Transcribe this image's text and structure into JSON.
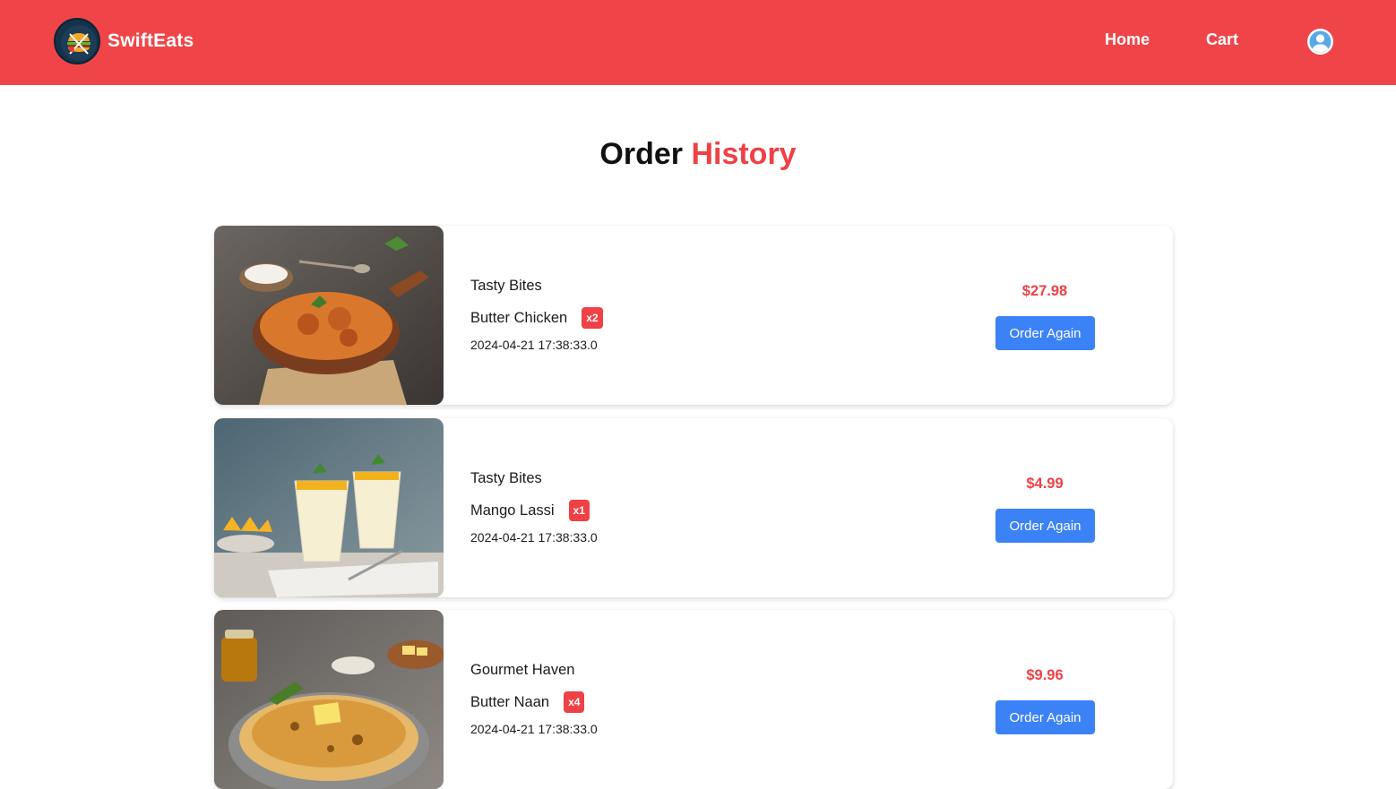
{
  "header": {
    "brand": "SwiftEats",
    "nav": {
      "home": "Home",
      "cart": "Cart"
    },
    "icons": {
      "logo": "burger-logo-icon",
      "profile": "user-avatar-icon"
    },
    "colors": {
      "navbar": "#f04548",
      "accent": "#ef4146",
      "button": "#3b82f6"
    }
  },
  "title": {
    "part1": "Order ",
    "part2": "History"
  },
  "orders": [
    {
      "restaurant": "Tasty Bites",
      "item": "Butter Chicken",
      "qty": "x2",
      "date": "2024-04-21 17:38:33.0",
      "price": "$27.98",
      "action": "Order Again",
      "image": "butter-chicken-photo"
    },
    {
      "restaurant": "Tasty Bites",
      "item": "Mango Lassi",
      "qty": "x1",
      "date": "2024-04-21 17:38:33.0",
      "price": "$4.99",
      "action": "Order Again",
      "image": "mango-lassi-photo"
    },
    {
      "restaurant": "Gourmet Haven",
      "item": "Butter Naan",
      "qty": "x4",
      "date": "2024-04-21 17:38:33.0",
      "price": "$9.96",
      "action": "Order Again",
      "image": "butter-naan-photo"
    }
  ]
}
